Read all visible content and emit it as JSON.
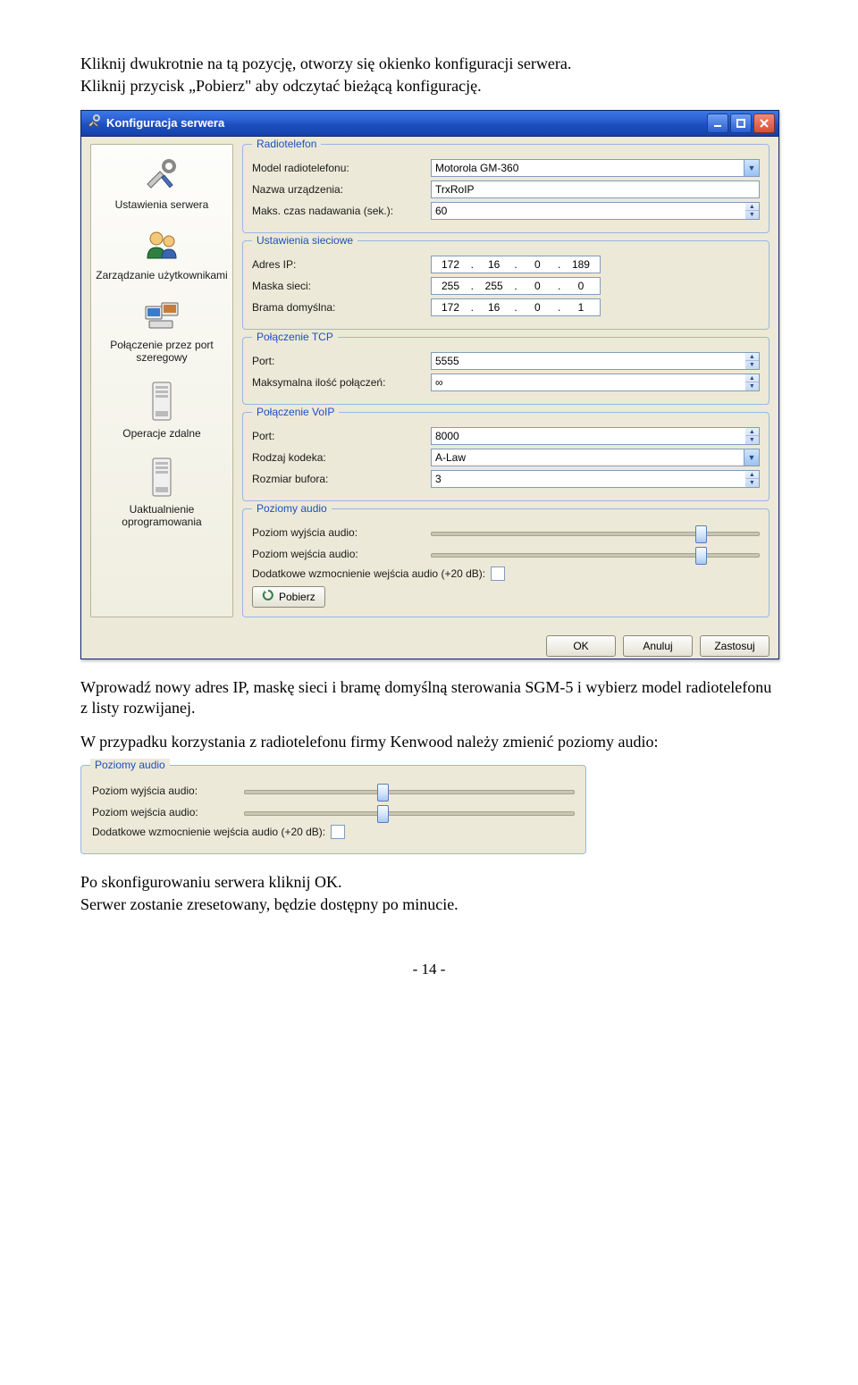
{
  "doc": {
    "intro_line1": "Kliknij dwukrotnie na tą pozycję, otworzy się okienko konfiguracji serwera.",
    "intro_line2": "Kliknij przycisk „Pobierz\" aby odczytać bieżącą konfigurację.",
    "after1": "Wprowadź nowy adres IP, maskę sieci i bramę domyślną sterowania SGM-5 i wybierz model radiotelefonu z listy rozwijanej.",
    "after2": "W przypadku korzystania z radiotelefonu firmy Kenwood należy zmienić poziomy audio:",
    "after3": "Po skonfigurowaniu serwera kliknij OK.",
    "after4": "Serwer zostanie zresetowany, będzie dostępny po minucie.",
    "page_number": "- 14 -"
  },
  "window": {
    "title": "Konfiguracja serwera",
    "sidebar": {
      "items": [
        {
          "label": "Ustawienia serwera"
        },
        {
          "label": "Zarządzanie użytkownikami"
        },
        {
          "label": "Połączenie przez port szeregowy"
        },
        {
          "label": "Operacje zdalne"
        },
        {
          "label": "Uaktualnienie oprogramowania"
        }
      ]
    },
    "radiotelefon": {
      "legend": "Radiotelefon",
      "model_label": "Model radiotelefonu:",
      "model_value": "Motorola GM-360",
      "device_label": "Nazwa urządzenia:",
      "device_value": "TrxRoIP",
      "maxtx_label": "Maks. czas nadawania (sek.):",
      "maxtx_value": "60"
    },
    "network": {
      "legend": "Ustawienia sieciowe",
      "ip_label": "Adres IP:",
      "ip": [
        "172",
        "16",
        "0",
        "189"
      ],
      "mask_label": "Maska sieci:",
      "mask": [
        "255",
        "255",
        "0",
        "0"
      ],
      "gw_label": "Brama domyślna:",
      "gw": [
        "172",
        "16",
        "0",
        "1"
      ]
    },
    "tcp": {
      "legend": "Połączenie TCP",
      "port_label": "Port:",
      "port_value": "5555",
      "maxconn_label": "Maksymalna ilość połączeń:",
      "maxconn_value": "∞"
    },
    "voip": {
      "legend": "Połączenie VoIP",
      "port_label": "Port:",
      "port_value": "8000",
      "codec_label": "Rodzaj kodeka:",
      "codec_value": "A-Law",
      "buf_label": "Rozmiar bufora:",
      "buf_value": "3"
    },
    "audio": {
      "legend": "Poziomy audio",
      "out_label": "Poziom wyjścia audio:",
      "in_label": "Poziom wejścia audio:",
      "gain_label": "Dodatkowe wzmocnienie wejścia audio (+20 dB):",
      "out_pos_pct": 82,
      "in_pos_pct": 82
    },
    "buttons": {
      "pobierz": "Pobierz",
      "ok": "OK",
      "anuluj": "Anuluj",
      "zastosuj": "Zastosuj"
    }
  },
  "audio_panel": {
    "legend": "Poziomy audio",
    "out_label": "Poziom wyjścia audio:",
    "in_label": "Poziom wejścia audio:",
    "gain_label": "Dodatkowe wzmocnienie wejścia audio (+20 dB):",
    "out_pos_pct": 42,
    "in_pos_pct": 42
  }
}
